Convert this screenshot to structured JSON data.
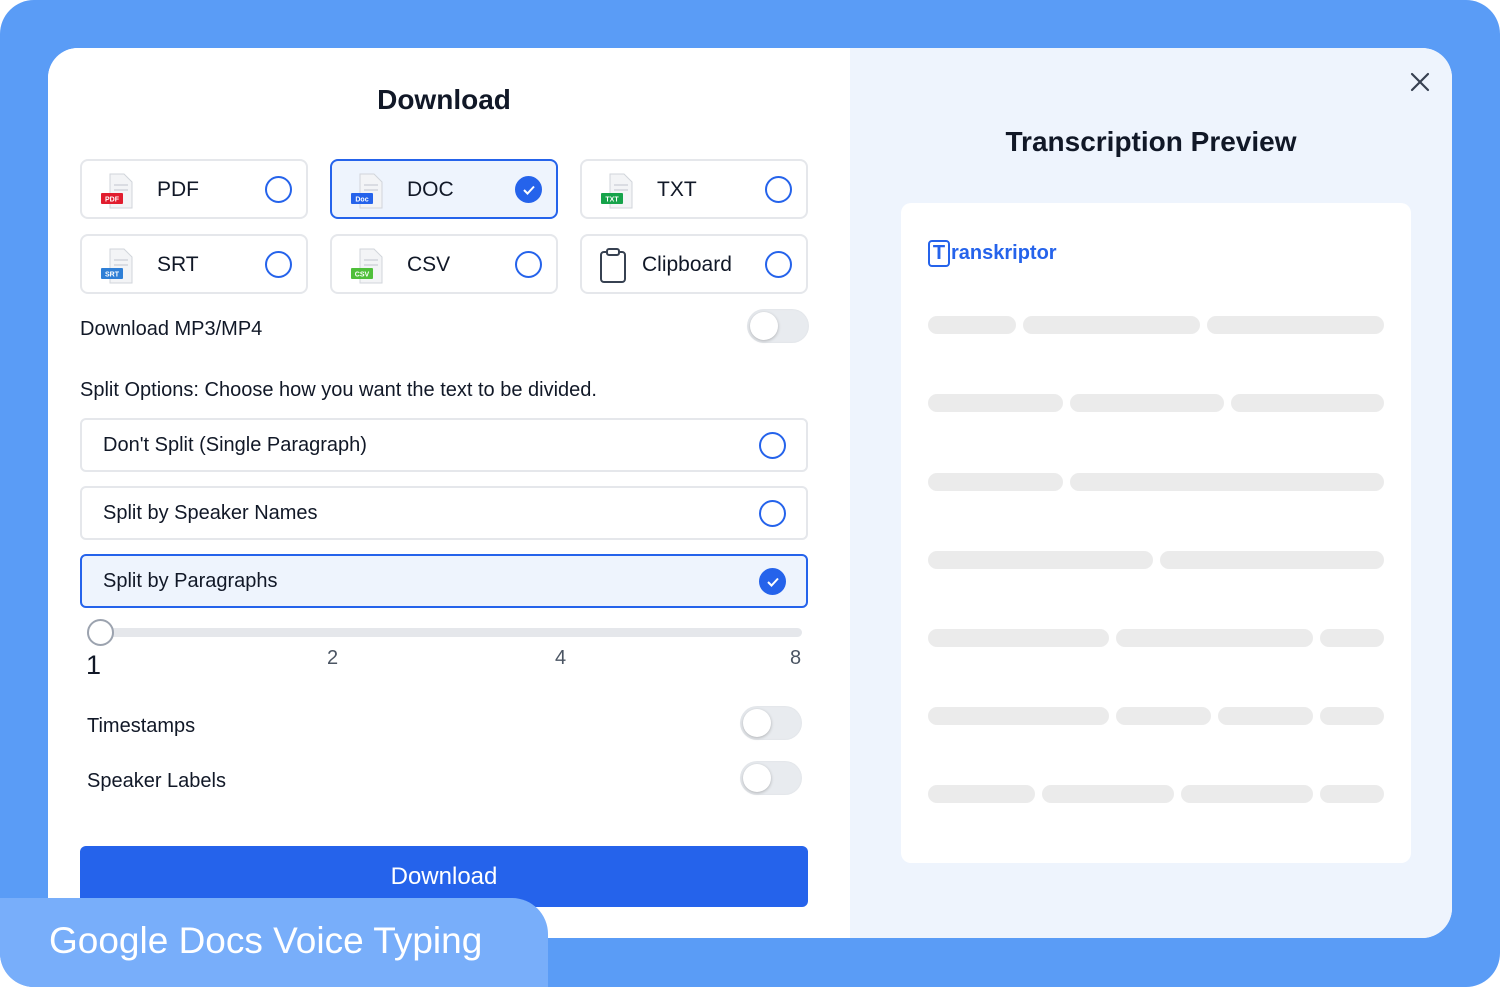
{
  "dialog": {
    "title": "Download",
    "formats": [
      {
        "label": "PDF",
        "badge": "PDF",
        "badge_color": "#e11d2e",
        "selected": false
      },
      {
        "label": "DOC",
        "badge": "Doc",
        "badge_color": "#2563eb",
        "selected": true
      },
      {
        "label": "TXT",
        "badge": "TXT",
        "badge_color": "#16a34a",
        "selected": false
      },
      {
        "label": "SRT",
        "badge": "SRT",
        "badge_color": "#2f7fd6",
        "selected": false
      },
      {
        "label": "CSV",
        "badge": "CSV",
        "badge_color": "#4fbf3a",
        "selected": false
      },
      {
        "label": "Clipboard",
        "icon": "clipboard-icon",
        "selected": false
      }
    ],
    "media_toggle": {
      "label": "Download MP3/MP4",
      "on": false
    },
    "split_heading": "Split Options: Choose how you want the text to be divided.",
    "split_options": [
      {
        "label": "Don't Split (Single Paragraph)",
        "selected": false
      },
      {
        "label": "Split by Speaker Names",
        "selected": false
      },
      {
        "label": "Split by Paragraphs",
        "selected": true
      }
    ],
    "slider": {
      "ticks": [
        "1",
        "2",
        "4",
        "8"
      ],
      "value": "1"
    },
    "timestamps": {
      "label": "Timestamps",
      "on": false
    },
    "speaker_labels": {
      "label": "Speaker Labels",
      "on": false
    },
    "download_button": "Download"
  },
  "preview": {
    "title": "Transcription Preview",
    "logo_letter": "T",
    "logo_rest": "ranskriptor"
  },
  "overlay_caption": "Google Docs Voice Typing",
  "colors": {
    "accent": "#2563eb",
    "frame": "#5a9cf6",
    "preview_bg": "#eef4fd"
  }
}
